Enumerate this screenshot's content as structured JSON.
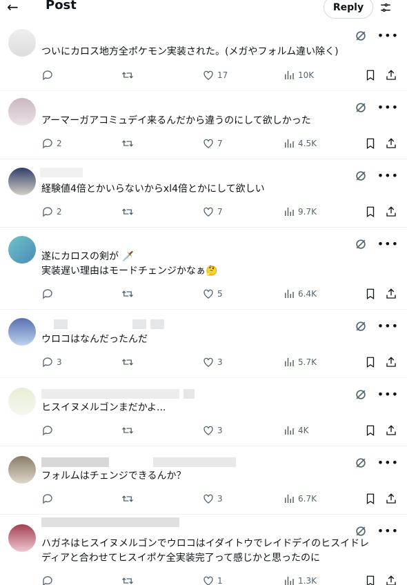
{
  "header": {
    "title": "Post",
    "reply_button": "Reply"
  },
  "posts": [
    {
      "text": "ついにカロス地方全ポケモン実装された。(メガやフォルム違い除く)",
      "replies": "",
      "likes": "17",
      "views": "10K"
    },
    {
      "text": "アーマーガアコミュデイ来るんだから違うのにして欲しかった",
      "replies": "2",
      "likes": "7",
      "views": "4.5K"
    },
    {
      "text": "経験値4倍とかいらないからxl4倍とかにして欲しい",
      "replies": "2",
      "likes": "7",
      "views": "9.7K"
    },
    {
      "text": "遂にカロスの剣が 🗡️\n実装遅い理由はモードチェンジかなぁ🤔",
      "replies": "",
      "likes": "5",
      "views": "6.4K"
    },
    {
      "text": "ウロコはなんだったんだ",
      "replies": "3",
      "likes": "3",
      "views": "5.7K"
    },
    {
      "text": "ヒスイヌメルゴンまだかよ...",
      "replies": "",
      "likes": "3",
      "views": "4K"
    },
    {
      "text": "フォルムはチェンジできるんか？",
      "replies": "",
      "likes": "3",
      "views": "6.7K"
    },
    {
      "text": "ハガネはヒスイヌメルゴンでウロコはイダイトウでレイドデイのヒスイドレ\nディアと合わせてヒスイポケ全実装完了って感じかと思ったのに",
      "replies": "",
      "likes": "1",
      "views": "1.3K"
    }
  ],
  "icons": [
    "back-arrow-icon",
    "filter-icon",
    "grok-icon",
    "more-icon",
    "reply-icon",
    "retweet-icon",
    "like-icon",
    "views-icon",
    "bookmark-icon",
    "share-icon"
  ],
  "colors": {
    "text": "#0f1419",
    "muted": "#536471",
    "border": "#eff3f4"
  }
}
